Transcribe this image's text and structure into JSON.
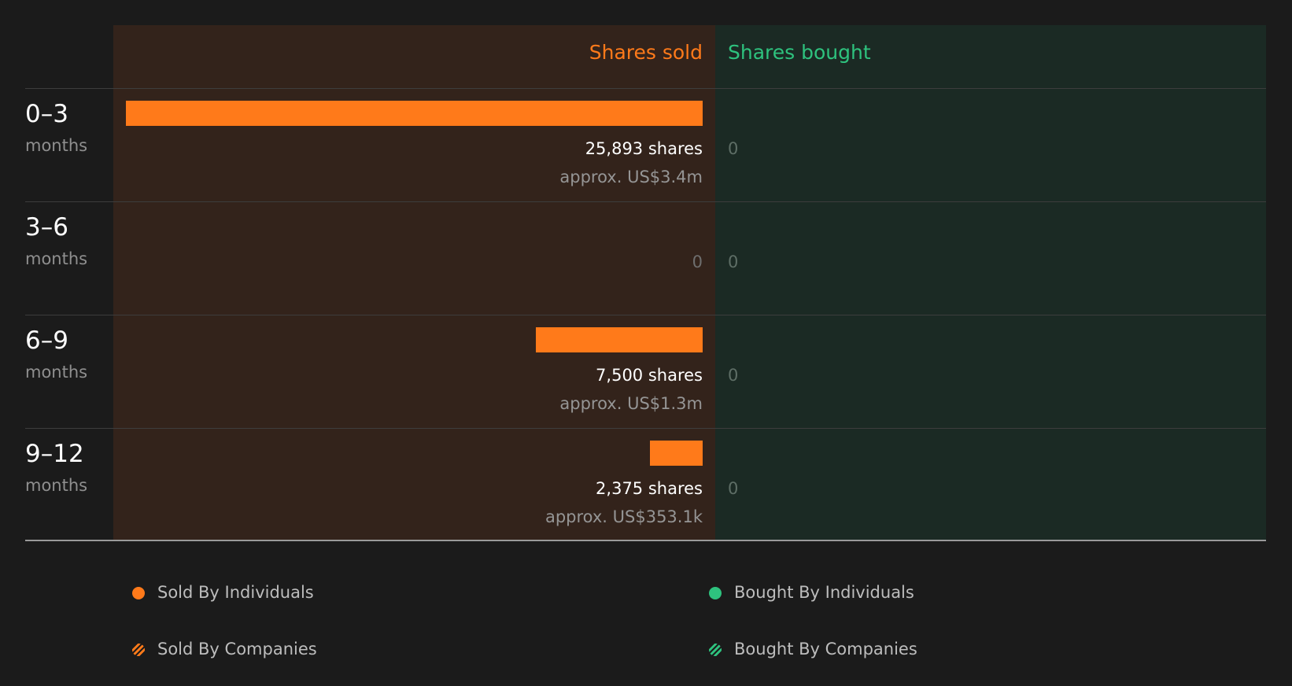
{
  "header": {
    "sold": "Shares sold",
    "bought": "Shares bought"
  },
  "colors": {
    "sold": "#ff7a1a",
    "bought": "#2ec27e"
  },
  "chart_data": {
    "type": "bar",
    "categories": [
      "0–3 months",
      "3–6 months",
      "6–9 months",
      "9–12 months"
    ],
    "series": [
      {
        "name": "Shares sold",
        "values": [
          25893,
          0,
          7500,
          2375
        ]
      },
      {
        "name": "Shares bought",
        "values": [
          0,
          0,
          0,
          0
        ]
      }
    ],
    "rows": [
      {
        "period": "0–3",
        "unit": "months",
        "sold": 25893,
        "sold_label": "25,893 shares",
        "sold_value": "approx. US$3.4m",
        "bought_label": "0"
      },
      {
        "period": "3–6",
        "unit": "months",
        "sold": 0,
        "sold_label": "0",
        "sold_value": "",
        "bought_label": "0"
      },
      {
        "period": "6–9",
        "unit": "months",
        "sold": 7500,
        "sold_label": "7,500 shares",
        "sold_value": "approx. US$1.3m",
        "bought_label": "0"
      },
      {
        "period": "9–12",
        "unit": "months",
        "sold": 2375,
        "sold_label": "2,375 shares",
        "sold_value": "approx. US$353.1k",
        "bought_label": "0"
      }
    ],
    "legend": [
      {
        "label": "Sold By Individuals",
        "style": "solid",
        "color": "#ff7a1a"
      },
      {
        "label": "Bought By Individuals",
        "style": "solid",
        "color": "#2ec27e"
      },
      {
        "label": "Sold By Companies",
        "style": "hatched",
        "color": "#ff7a1a"
      },
      {
        "label": "Bought By Companies",
        "style": "hatched",
        "color": "#2ec27e"
      }
    ]
  }
}
